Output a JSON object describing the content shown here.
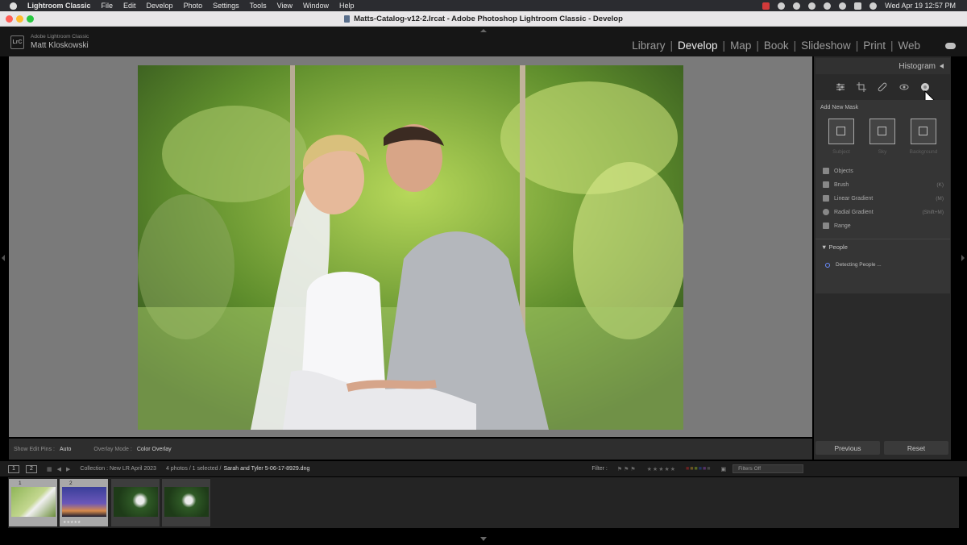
{
  "menubar": {
    "app_name": "Lightroom Classic",
    "items": [
      "File",
      "Edit",
      "Develop",
      "Photo",
      "Settings",
      "Tools",
      "View",
      "Window",
      "Help"
    ],
    "datetime": "Wed Apr 19  12:57 PM"
  },
  "window": {
    "title": "Matts-Catalog-v12-2.lrcat - Adobe Photoshop Lightroom Classic - Develop"
  },
  "identity": {
    "small": "Adobe Lightroom Classic",
    "name": "Matt Kloskowski",
    "logo_text": "LrC"
  },
  "modules": [
    "Library",
    "Develop",
    "Map",
    "Book",
    "Slideshow",
    "Print",
    "Web"
  ],
  "active_module": "Develop",
  "right_panel": {
    "histogram_label": "Histogram",
    "add_mask_label": "Add New Mask",
    "mask_buttons": [
      "Subject",
      "Sky",
      "Background"
    ],
    "mask_tools": [
      {
        "label": "Objects",
        "shortcut": ""
      },
      {
        "label": "Brush",
        "shortcut": "(K)"
      },
      {
        "label": "Linear Gradient",
        "shortcut": "(M)"
      },
      {
        "label": "Radial Gradient",
        "shortcut": "(Shift+M)"
      },
      {
        "label": "Range",
        "shortcut": ""
      }
    ],
    "people_label": "People",
    "detecting_label": "Detecting People ...",
    "previous_label": "Previous",
    "reset_label": "Reset"
  },
  "toolbar": {
    "show_edit_pins_label": "Show Edit Pins :",
    "show_edit_pins_value": "Auto",
    "overlay_mode_label": "Overlay Mode :",
    "overlay_mode_value": "Color Overlay"
  },
  "filmstrip_bar": {
    "page1": "1",
    "page2": "2",
    "collection": "Collection : New LR April 2023",
    "count": "4 photos / 1 selected /",
    "filename": "Sarah and Tyler 5-06-17-8929.dng",
    "filter_label": "Filter :",
    "filters_value": "Filters Off"
  },
  "filmstrip": {
    "thumbs": [
      {
        "num": "1"
      },
      {
        "num": "2",
        "stars": "★★★★★"
      },
      {
        "num": "2"
      },
      {
        "num": ""
      }
    ]
  },
  "colors": {
    "accent": "#6a8cff",
    "panel": "#2a2a2a",
    "canvas": "#7a7a7a"
  }
}
